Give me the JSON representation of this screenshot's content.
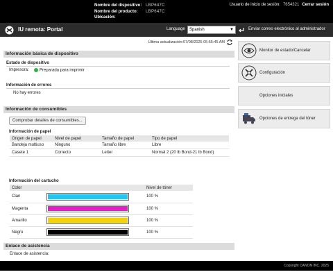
{
  "header": {
    "device_name_label": "Nombre del dispositivo:",
    "device_name_value": "LBP647C",
    "product_name_label": "Nombre del producto:",
    "product_name_value": "LBP647C",
    "location_label": "Ubicación:",
    "location_value": "",
    "login_user_label": "Usuario de inicio de sesión:",
    "login_user_value": "7654321",
    "logout_label": "Cerrar sesión"
  },
  "portal": {
    "title": "IU remota: Portal",
    "language_label": "Language",
    "language_value": "Spanish",
    "mail_admin_label": "Enviar correo electrónico al administrador"
  },
  "last_update": "Última actualización:07/08/2025 05:55:45 AM",
  "device_basic": {
    "section_title": "Información básica de dispositivo",
    "status_title": "Estado de dispositivo",
    "printer_label": "Impresora:",
    "printer_status": "Preparada para imprimir",
    "error_title": "Información de errores",
    "error_text": "No hay errores"
  },
  "consumables": {
    "section_title": "Información de consumibles",
    "check_button": "Comprobar detalles de consumibles...",
    "paper_title": "Información de papel",
    "paper_headers": [
      "Origen de papel",
      "Nivel de papel",
      "Tamaño de papel",
      "Tipo de papel"
    ],
    "paper_rows": [
      [
        "Bandeja multiuso",
        "Ninguno",
        "Tamaño libre",
        "Libre"
      ],
      [
        "Casete 1",
        "Correcto",
        "Letter",
        "Normal 2 (20 lb Bond-21 lb Bond)"
      ]
    ],
    "cartridge_title": "Información del cartucho",
    "cartridge_headers": [
      "Color",
      "",
      "Nivel de tóner"
    ],
    "cartridges": [
      {
        "name": "Cian",
        "level_text": "100 %",
        "level": 100,
        "color": "#23c4f0"
      },
      {
        "name": "Magenta",
        "level_text": "100 %",
        "level": 100,
        "color": "#e61ec8"
      },
      {
        "name": "Amarillo",
        "level_text": "100 %",
        "level": 100,
        "color": "#f6d20a"
      },
      {
        "name": "Negro",
        "level_text": "100 %",
        "level": 100,
        "color": "#000000"
      }
    ]
  },
  "support": {
    "section_title": "Enlace de asistencia",
    "link_label": "Enlace de asistencia:"
  },
  "side_menu": {
    "monitor": "Monitor de estado/Cancelar",
    "settings": "Configuración",
    "initial": "Opciones iniciales",
    "toner": "Opciones de entrega del tóner"
  },
  "footer": {
    "copyright": "Copyright CANON INC. 2025"
  }
}
